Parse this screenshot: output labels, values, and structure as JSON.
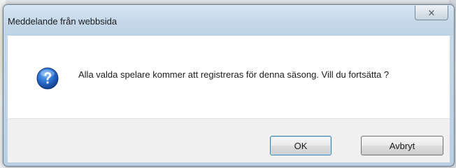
{
  "dialog": {
    "title": "Meddelande från webbsida",
    "close_glyph": "✕",
    "message": "Alla valda spelare kommer att registreras för denna säsong. Vill du fortsätta ?",
    "icon": "question-icon",
    "buttons": {
      "ok_label": "OK",
      "cancel_label": "Avbryt"
    }
  },
  "colors": {
    "icon_blue": "#1f5fb5",
    "ok_border": "#3c7fb1"
  }
}
